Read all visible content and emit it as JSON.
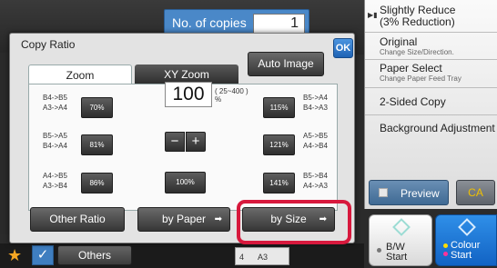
{
  "header": {
    "copies_label": "No. of copies",
    "copies_value": "1"
  },
  "side_menu": [
    {
      "main": "Slightly Reduce\n(3% Reduction)",
      "sub": ""
    },
    {
      "main": "Original",
      "sub": "Change Size/Direction."
    },
    {
      "main": "Paper Select",
      "sub": "Change Paper Feed Tray"
    },
    {
      "main": "2-Sided Copy",
      "sub": ""
    },
    {
      "main": "Background Adjustment",
      "sub": ""
    }
  ],
  "actions": {
    "preview": "Preview",
    "ca": "CA",
    "bw": "B/W\nStart",
    "colour": "Colour\nStart",
    "others": "Others"
  },
  "tray": {
    "number": "4",
    "size": "A3"
  },
  "dialog": {
    "title": "Copy Ratio",
    "ok": "OK",
    "tabs": [
      "Zoom",
      "XY Zoom"
    ],
    "auto_image": "Auto Image",
    "presets_left": [
      {
        "sizes": "B4->B5\nA3->A4",
        "ratio": "70%"
      },
      {
        "sizes": "B5->A5\nB4->A4",
        "ratio": "81%"
      },
      {
        "sizes": "A4->B5\nA3->B4",
        "ratio": "86%"
      }
    ],
    "presets_right": [
      {
        "sizes": "B5->A4\nB4->A3",
        "ratio": "115%"
      },
      {
        "sizes": "A5->B5\nA4->B4",
        "ratio": "121%"
      },
      {
        "sizes": "B5->B4\nA4->A3",
        "ratio": "141%"
      }
    ],
    "ratio_value": "100",
    "ratio_range": "( 25~400 )\n%",
    "minus": "−",
    "plus": "+",
    "hundred": "100%",
    "other_ratio": "Other Ratio",
    "by_paper": "by Paper",
    "by_size": "by Size"
  },
  "colors": {
    "highlight": "#d7193d",
    "accent_blue": "#1f6fd0",
    "ca_text": "#f0c000"
  }
}
